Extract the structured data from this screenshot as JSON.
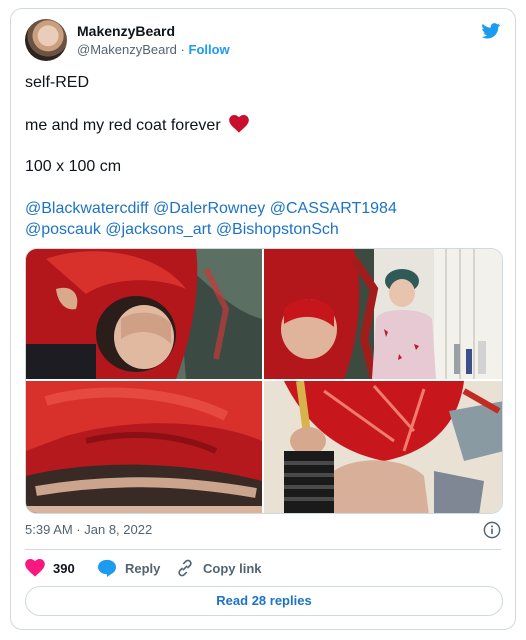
{
  "user": {
    "display_name": "MakenzyBeard",
    "handle": "@MakenzyBeard",
    "separator": "·",
    "follow_label": "Follow"
  },
  "tweet": {
    "line1": "self-RED",
    "line2": "me and my red coat forever",
    "line3": "100 x 100 cm",
    "mentions_row1": [
      "@Blackwatercdiff",
      "@DalerRowney",
      "@CASSART1984"
    ],
    "mentions_row2": [
      "@poscauk",
      "@jacksons_art",
      "@BishopstonSch"
    ]
  },
  "meta": {
    "timestamp": "5:39 AM · Jan 8, 2022"
  },
  "actions": {
    "likes": "390",
    "reply_label": "Reply",
    "copy_label": "Copy link"
  },
  "read_replies": "Read 28 replies",
  "colors": {
    "accent": "#1d9bf0",
    "link": "#1d73c5",
    "heart": "#f91880",
    "border": "#cfd9de",
    "muted": "#536471"
  },
  "icons": [
    "twitter-bird-icon",
    "red-heart-emoji-icon",
    "heart-icon",
    "reply-bubble-icon",
    "link-icon",
    "info-icon"
  ]
}
